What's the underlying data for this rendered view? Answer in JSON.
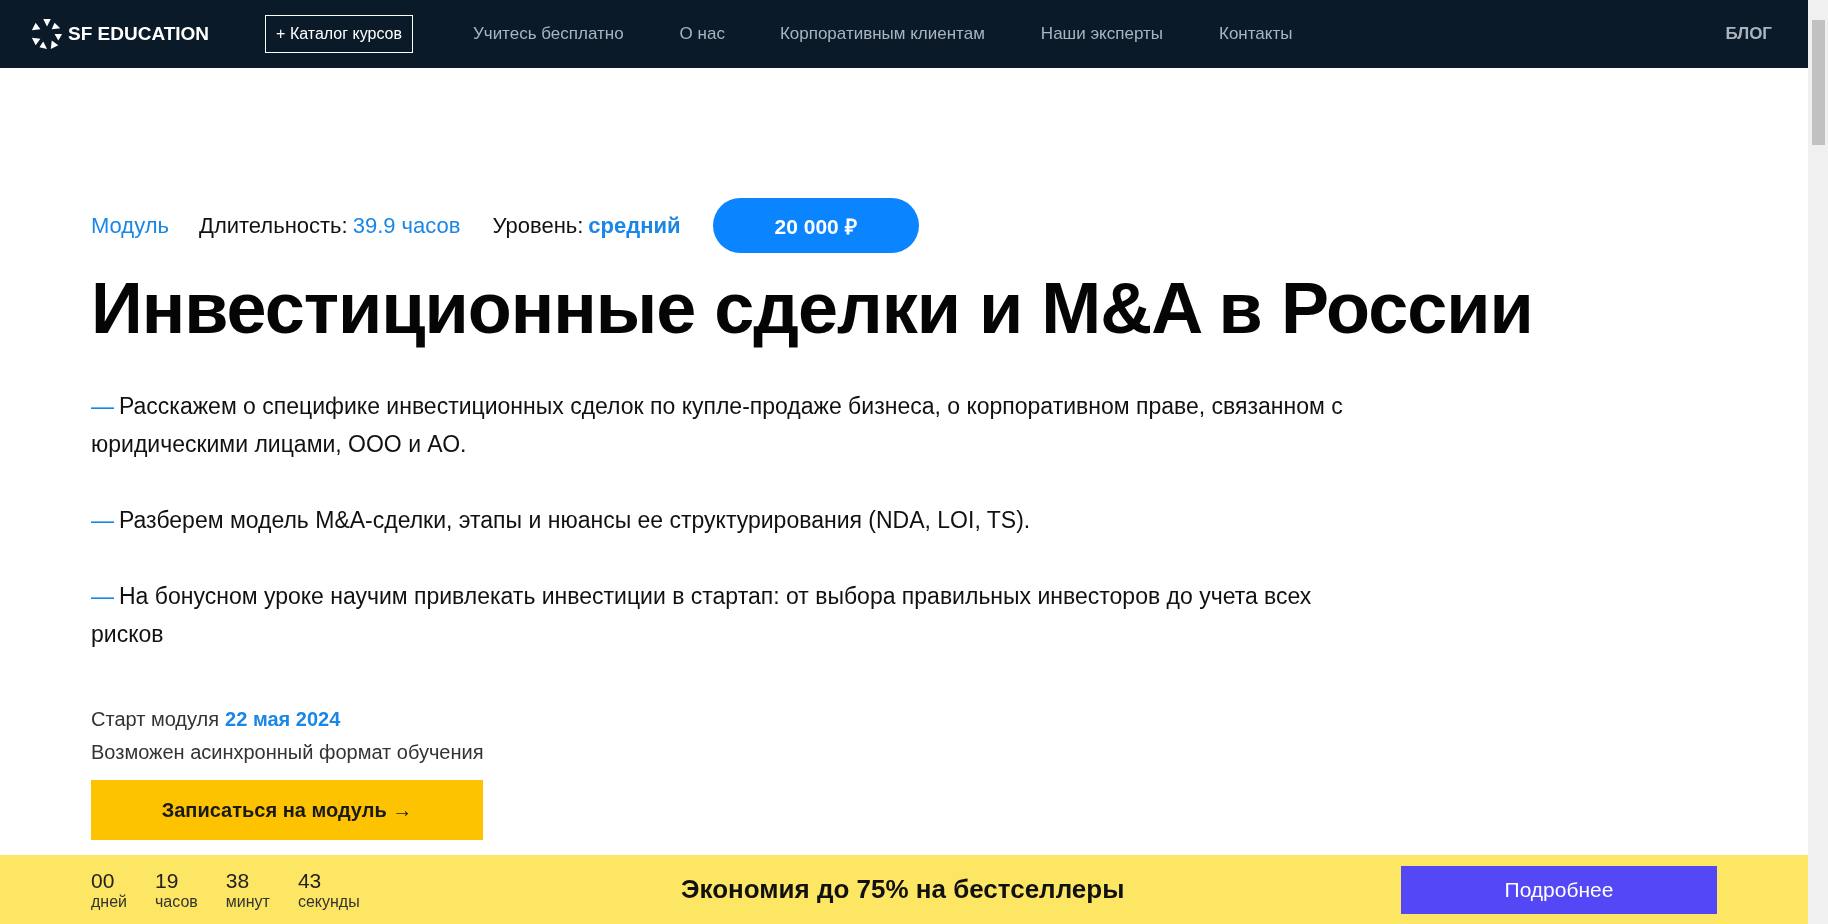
{
  "header": {
    "logo": "SF EDUCATION",
    "catalog_button": "+ Каталог курсов",
    "nav": [
      "Учитесь бесплатно",
      "О нас",
      "Корпоративным клиентам",
      "Наши эксперты",
      "Контакты"
    ],
    "blog": "БЛОГ"
  },
  "meta": {
    "type": "Модуль",
    "duration_label": "Длительность:",
    "duration": "39.9 часов",
    "level_label": "Уровень:",
    "level_value": "средний",
    "price": "20 000 ₽"
  },
  "title": "Инвестиционные сделки и M&A в России",
  "points": [
    {
      "bullet": "—",
      "text": "Расскажем о специфике инвестиционных сделок по купле-продаже бизнеса, о корпоративном праве, связанном с юридическими лицами, ООО и АО."
    },
    {
      "bullet": "—",
      "text": "Разберем модель M&A-сделки, этапы и нюансы ее структурирования (NDA, LOI, TS)."
    },
    {
      "bullet": "—",
      "text": "На бонусном уроке научим привлекать инвестиции в стартап: от выбора правильных инвесторов до учета всех рисков"
    }
  ],
  "start": {
    "label": "Старт модуля",
    "date": "22 мая 2024",
    "note": "Возможен асинхронный формат обучения"
  },
  "enroll_button": "Записаться на модуль →",
  "promo": {
    "countdown": [
      {
        "value": "00",
        "unit": "дней"
      },
      {
        "value": "19",
        "unit": "часов"
      },
      {
        "value": "38",
        "unit": "минут"
      },
      {
        "value": "43",
        "unit": "секунды"
      }
    ],
    "text": "Экономия до 75% на бестселлеры",
    "button": "Подробнее"
  }
}
